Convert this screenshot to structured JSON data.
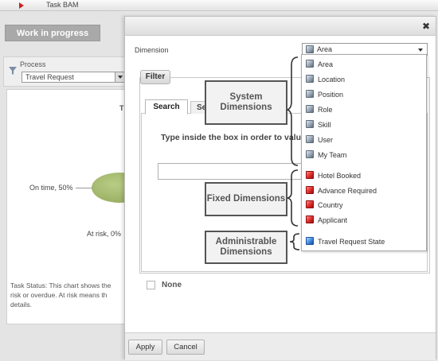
{
  "topbar": {
    "title": "Task BAM"
  },
  "left": {
    "wip_button": "Work in progress",
    "process_label": "Process",
    "process_value": "Travel Request",
    "chart_title_letter": "T",
    "label_ontime": "On time, 50%",
    "label_atrisk": "At risk, 0%",
    "task_status_prefix": "Task Status:",
    "task_status_text": "This chart shows the risk or overdue. At risk means th details."
  },
  "dialog": {
    "close_icon": "close-icon",
    "dimension_label": "Dimension",
    "dimension_selected": "Area",
    "filter_tab": "Filter",
    "tab_search": "Search",
    "tab_second": "Se",
    "hint": "Type inside the box in order to values",
    "search_value": "",
    "none_label": "None",
    "apply": "Apply",
    "cancel": "Cancel"
  },
  "dropdown": {
    "system": [
      {
        "label": "Area",
        "icon": "gray-cube-icon"
      },
      {
        "label": "Location",
        "icon": "gray-cube-icon"
      },
      {
        "label": "Position",
        "icon": "gray-cube-icon"
      },
      {
        "label": "Role",
        "icon": "gray-cube-icon"
      },
      {
        "label": "Skill",
        "icon": "gray-cube-icon"
      },
      {
        "label": "User",
        "icon": "gray-cube-icon"
      },
      {
        "label": "My Team",
        "icon": "gray-cube-icon"
      }
    ],
    "fixed": [
      {
        "label": "Hotel Booked",
        "icon": "red-cube-icon"
      },
      {
        "label": "Advance Required",
        "icon": "red-cube-icon"
      },
      {
        "label": "Country",
        "icon": "red-cube-icon"
      },
      {
        "label": "Applicant",
        "icon": "red-cube-icon"
      }
    ],
    "admin": [
      {
        "label": "Travel Request State",
        "icon": "blue-cube-icon"
      }
    ]
  },
  "callouts": {
    "system": "System Dimensions",
    "fixed": "Fixed Dimensions",
    "admin": "Administrable Dimensions"
  },
  "colors": {
    "system_cube": "#8d9aa8",
    "fixed_cube": "#dd2a2a",
    "admin_cube": "#3f8ae0",
    "pie_green": "#9fb566",
    "topbar_arrow": "#cc2222"
  }
}
